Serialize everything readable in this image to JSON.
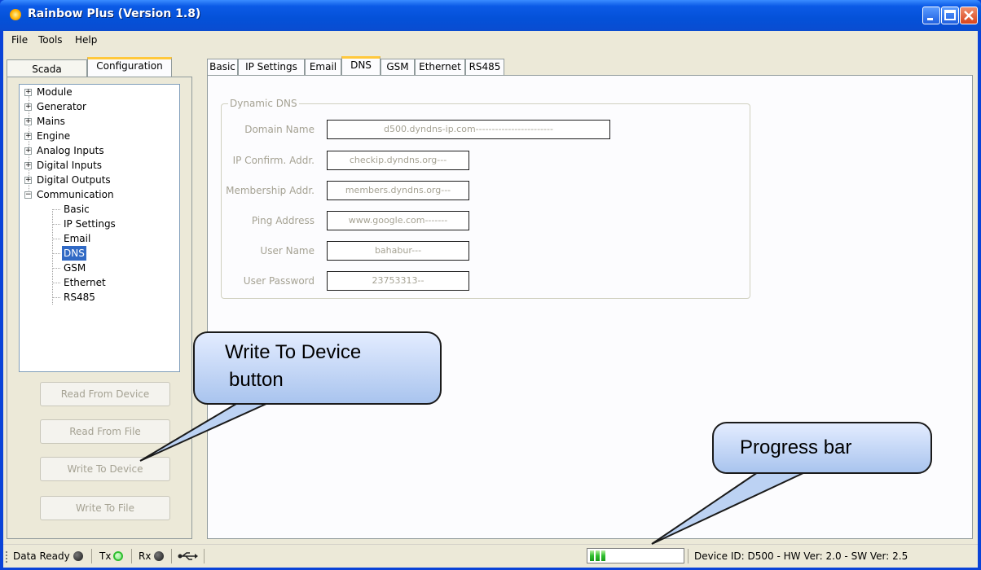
{
  "window": {
    "title": "Rainbow Plus (Version 1.8)"
  },
  "menu": [
    "File",
    "Tools",
    "Help"
  ],
  "left_tabs": {
    "scada": "Scada",
    "configuration": "Configuration"
  },
  "tree": {
    "roots": [
      "Module",
      "Generator",
      "Mains",
      "Engine",
      "Analog Inputs",
      "Digital Inputs",
      "Digital Outputs",
      "Communication"
    ],
    "children": [
      "Basic",
      "IP Settings",
      "Email",
      "DNS",
      "GSM",
      "Ethernet",
      "RS485"
    ],
    "selected": "DNS"
  },
  "buttons": {
    "read_device": "Read From Device",
    "read_file": "Read From File",
    "write_device": "Write To Device",
    "write_file": "Write To File"
  },
  "tabs": [
    "Basic",
    "IP Settings",
    "Email",
    "DNS",
    "GSM",
    "Ethernet",
    "RS485"
  ],
  "active_tab": "DNS",
  "dns": {
    "group_title": "Dynamic DNS",
    "fields": [
      {
        "label": "Domain Name",
        "value": "d500.dyndns-ip.com------------------------"
      },
      {
        "label": "IP Confirm. Addr.",
        "value": "checkip.dyndns.org---"
      },
      {
        "label": "Membership Addr.",
        "value": "members.dyndns.org---"
      },
      {
        "label": "Ping Address",
        "value": "www.google.com-------"
      },
      {
        "label": "User Name",
        "value": "bahabur---"
      },
      {
        "label": "User Password",
        "value": "23753313--"
      }
    ]
  },
  "status": {
    "data_ready": "Data Ready",
    "tx": "Tx",
    "rx": "Rx",
    "progress_percent": 18,
    "device_info": "Device ID: D500 - HW Ver: 2.0 - SW Ver: 2.5"
  },
  "callouts": {
    "write_line1": "Write To Device",
    "write_line2": "button",
    "progress": "Progress bar"
  },
  "colors": {
    "title_blue": "#0451d8",
    "selection": "#316ac5",
    "tab_highlight": "#ffc83c",
    "led_green": "#2fbf2f",
    "callout_fill": "#bcd2f3"
  }
}
